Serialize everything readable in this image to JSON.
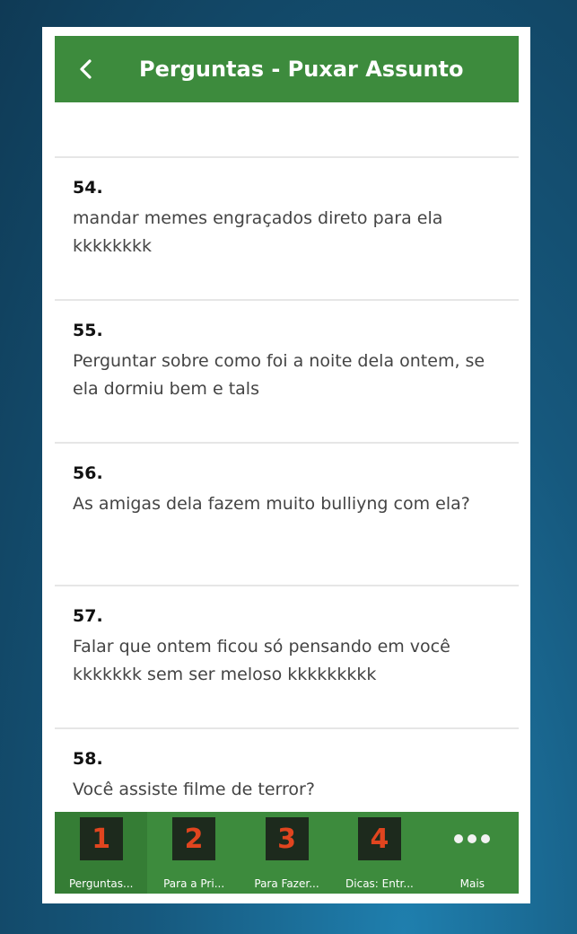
{
  "header": {
    "title": "Perguntas - Puxar Assunto"
  },
  "items": [
    {
      "number": "54.",
      "text": "mandar memes engraçados direto para ela kkkkkkkk"
    },
    {
      "number": "55.",
      "text": "Perguntar sobre como foi a noite dela ontem, se ela dormiu bem e tals"
    },
    {
      "number": "56.",
      "text": "As amigas dela fazem muito bulliyng com ela?"
    },
    {
      "number": "57.",
      "text": "Falar que ontem ficou só pensando em você kkkkkkk sem ser meloso kkkkkkkkk"
    },
    {
      "number": "58.",
      "text": "Você assiste filme de terror?"
    }
  ],
  "tabs": [
    {
      "badge": "1",
      "label": "Perguntas..."
    },
    {
      "badge": "2",
      "label": "Para a Pri..."
    },
    {
      "badge": "3",
      "label": "Para Fazer..."
    },
    {
      "badge": "4",
      "label": "Dicas: Entr..."
    },
    {
      "badge": "",
      "label": "Mais"
    }
  ],
  "colors": {
    "header_bg": "#3d8b3d",
    "tab_badge_digit": "#e0451f",
    "tab_badge_bg": "#1d2a1d"
  },
  "icons": {
    "back": "chevron-left-icon",
    "more": "more-dots-icon"
  }
}
